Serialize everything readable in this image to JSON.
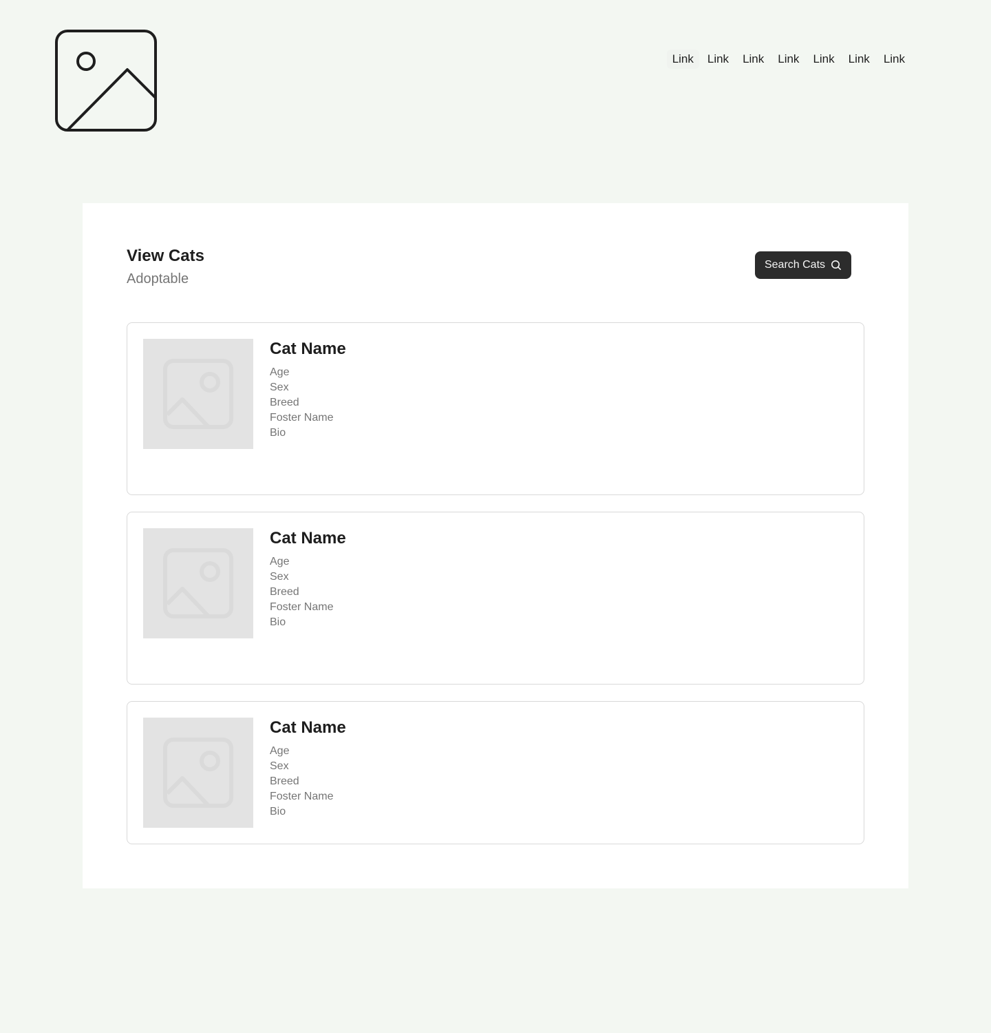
{
  "header": {
    "logo_icon": "image-placeholder-icon",
    "nav_links": [
      "Link",
      "Link",
      "Link",
      "Link",
      "Link",
      "Link",
      "Link"
    ]
  },
  "main": {
    "title": "View Cats",
    "subtitle": "Adoptable",
    "search_button": {
      "label": "Search Cats",
      "icon": "search-icon"
    },
    "cats": [
      {
        "name": "Cat Name",
        "age": "Age",
        "sex": "Sex",
        "breed": "Breed",
        "foster": "Foster Name",
        "bio": "Bio",
        "image_icon": "image-placeholder-icon"
      },
      {
        "name": "Cat Name",
        "age": "Age",
        "sex": "Sex",
        "breed": "Breed",
        "foster": "Foster Name",
        "bio": "Bio",
        "image_icon": "image-placeholder-icon"
      },
      {
        "name": "Cat Name",
        "age": "Age",
        "sex": "Sex",
        "breed": "Breed",
        "foster": "Foster Name",
        "bio": "Bio",
        "image_icon": "image-placeholder-icon"
      }
    ]
  },
  "colors": {
    "page_background": "#f3f7f2",
    "panel_background": "#ffffff",
    "button_background": "#2c2c2c",
    "text_primary": "#1e1e1e",
    "text_secondary": "#757575",
    "placeholder_background": "#e3e3e3",
    "card_border": "#d9d9d9"
  }
}
